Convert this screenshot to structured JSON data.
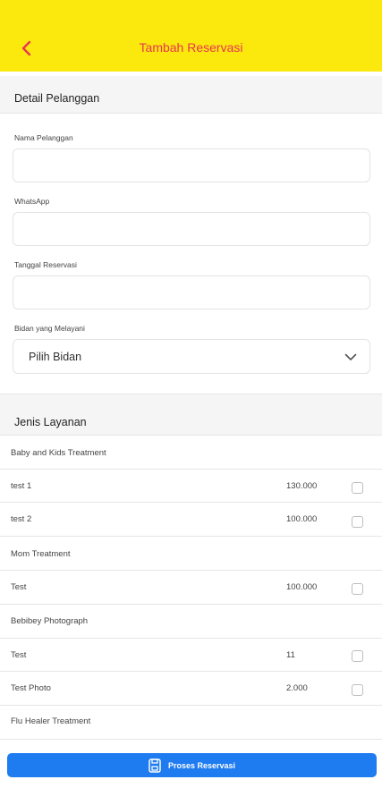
{
  "appbar": {
    "title": "Tambah Reservasi",
    "back_icon": "chevron-left-icon",
    "bg_color": "#fbe90e",
    "title_color": "#e8364f"
  },
  "customer_section": {
    "title": "Detail Pelanggan",
    "name_label": "Nama Pelanggan",
    "name_value": "",
    "whatsapp_label": "WhatsApp",
    "whatsapp_value": "",
    "date_label": "Tanggal Reservasi",
    "date_value": "",
    "midwife_label": "Bidan yang Melayani",
    "midwife_selected": "Pilih Bidan"
  },
  "services_section": {
    "title": "Jenis Layanan",
    "categories": [
      {
        "name": "Baby and Kids Treatment",
        "items": [
          {
            "name": "test 1",
            "price": "130.000",
            "checked": false
          },
          {
            "name": "test 2",
            "price": "100.000",
            "checked": false
          }
        ]
      },
      {
        "name": "Mom Treatment",
        "items": [
          {
            "name": "Test",
            "price": "100.000",
            "checked": false
          }
        ]
      },
      {
        "name": "Bebibey Photograph",
        "items": [
          {
            "name": "Test",
            "price": "11",
            "checked": false
          },
          {
            "name": "Test Photo",
            "price": "2.000",
            "checked": false
          }
        ]
      },
      {
        "name": "Flu Healer Treatment",
        "items": []
      }
    ]
  },
  "submit": {
    "label": "Proses Reservasi",
    "icon": "save-icon",
    "color": "#1e7bf0"
  }
}
